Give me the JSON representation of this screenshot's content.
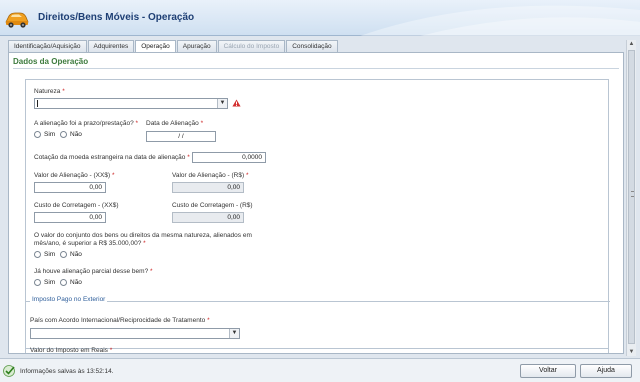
{
  "header": {
    "title": "Direitos/Bens Móveis - Operação",
    "logo_icon": "car-icon"
  },
  "tabs": [
    {
      "label": "Identificação/Aquisição",
      "state": "normal"
    },
    {
      "label": "Adquirentes",
      "state": "normal"
    },
    {
      "label": "Operação",
      "state": "active"
    },
    {
      "label": "Apuração",
      "state": "normal"
    },
    {
      "label": "Cálculo do Imposto",
      "state": "disabled"
    },
    {
      "label": "Consolidação",
      "state": "normal"
    }
  ],
  "section": {
    "title": "Dados da Operação"
  },
  "form": {
    "natureza": {
      "label": "Natureza",
      "required": "*",
      "value": ""
    },
    "prazo": {
      "label": "A alienação foi a prazo/prestação?",
      "required": "*",
      "options": [
        "Sim",
        "Não"
      ]
    },
    "data_alienacao": {
      "label": "Data de Alienação",
      "required": "*",
      "value": "/ /"
    },
    "cotacao": {
      "label": "Cotação da moeda estrangeira na data de alienação",
      "required": "*",
      "value": "0,0000"
    },
    "valor_alienacao_xx": {
      "label": "Valor de Alienação - (XX$)",
      "required": "*",
      "value": "0,00"
    },
    "valor_alienacao_rs": {
      "label": "Valor de Alienação - (R$)",
      "required": "*",
      "value": "0,00"
    },
    "custo_corretagem_xx": {
      "label": "Custo de Corretagem - (XX$)",
      "value": "0,00"
    },
    "custo_corretagem_rs": {
      "label": "Custo de Corretagem - (R$)",
      "value": "0,00"
    },
    "valor_conjunto": {
      "label_line1": "O valor do conjunto dos bens ou direitos da mesma natureza, alienados em",
      "label_line2": "mês/ano, é superior a R$ 35.000,00?",
      "required": "*",
      "options": [
        "Sim",
        "Não"
      ]
    },
    "alienacao_parcial": {
      "label": "Já houve alienação parcial desse bem?",
      "required": "*",
      "options": [
        "Sim",
        "Não"
      ]
    }
  },
  "imposto_exterior": {
    "legend": "Imposto Pago no Exterior",
    "pais": {
      "label": "País com Acordo Internacional/Reciprocidade de Tratamento",
      "required": "*",
      "value": ""
    },
    "valor_imposto": {
      "label": "Valor do Imposto em Reais",
      "required": "*"
    }
  },
  "footer": {
    "status": "Informações salvas às 13:52:14.",
    "back_button": "Voltar",
    "help_button": "Ajuda"
  },
  "colors": {
    "section_title": "#3c7a3c",
    "header_title": "#1e3f74",
    "required": "#cc2222",
    "legend": "#2d5d9a"
  }
}
